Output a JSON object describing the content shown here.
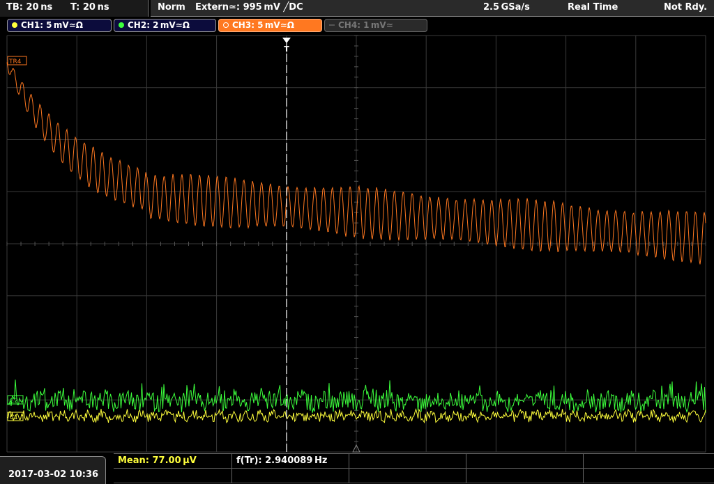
{
  "topbar": {
    "timebase": "TB: 20 ns",
    "trigger_time": "T: 20 ns",
    "trigger_mode": "Norm",
    "trigger_source": "Extern≃: 995 mV ╱DC",
    "sample_rate": "2.5 GSa/s",
    "acq_mode": "Real Time",
    "status": "Not Rdy."
  },
  "channels": [
    {
      "label": "CH1: 5 mV≃Ω",
      "color": "#ffff3c",
      "active": true
    },
    {
      "label": "CH2: 2 mV≃Ω",
      "color": "#3cff3c",
      "active": true
    },
    {
      "label": "CH3: 5 mV≃Ω",
      "color": "#ff7820",
      "active": true,
      "selected": true
    },
    {
      "label": "CH4: 1 mV≃",
      "color": "#777777",
      "active": false
    }
  ],
  "markers": {
    "ch3": "TR4",
    "ch2": "C2",
    "ch1": "C1"
  },
  "trigger_marker": "T",
  "bottom": {
    "datetime": "2017-03-02 10:36",
    "meas1": "Mean: 77.00 µV",
    "meas2": "f(Tr): 2.940089 Hz"
  }
}
